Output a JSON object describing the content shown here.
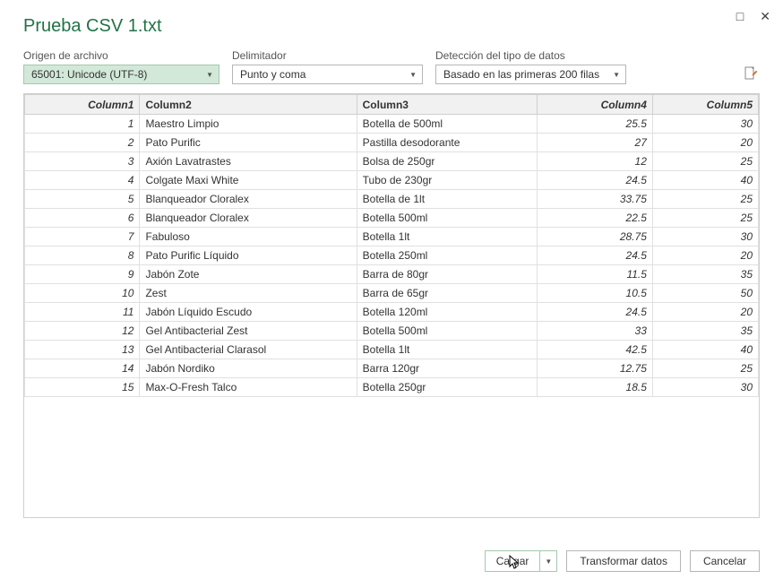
{
  "window": {
    "title": "Prueba CSV 1.txt"
  },
  "controls": {
    "origin_label": "Origen de archivo",
    "origin_value": "65001: Unicode (UTF-8)",
    "delimiter_label": "Delimitador",
    "delimiter_value": "Punto y coma",
    "detect_label": "Detección del tipo de datos",
    "detect_value": "Basado en las primeras 200 filas"
  },
  "table": {
    "headers": [
      "Column1",
      "Column2",
      "Column3",
      "Column4",
      "Column5"
    ],
    "rows": [
      {
        "c1": "1",
        "c2": "Maestro Limpio",
        "c3": "Botella de 500ml",
        "c4": "25.5",
        "c5": "30"
      },
      {
        "c1": "2",
        "c2": "Pato Purific",
        "c3": "Pastilla desodorante",
        "c4": "27",
        "c5": "20"
      },
      {
        "c1": "3",
        "c2": "Axión Lavatrastes",
        "c3": "Bolsa de 250gr",
        "c4": "12",
        "c5": "25"
      },
      {
        "c1": "4",
        "c2": "Colgate Maxi White",
        "c3": "Tubo de 230gr",
        "c4": "24.5",
        "c5": "40"
      },
      {
        "c1": "5",
        "c2": "Blanqueador Cloralex",
        "c3": "Botella de 1lt",
        "c4": "33.75",
        "c5": "25"
      },
      {
        "c1": "6",
        "c2": "Blanqueador Cloralex",
        "c3": "Botella 500ml",
        "c4": "22.5",
        "c5": "25"
      },
      {
        "c1": "7",
        "c2": "Fabuloso",
        "c3": "Botella 1lt",
        "c4": "28.75",
        "c5": "30"
      },
      {
        "c1": "8",
        "c2": "Pato Purific Líquido",
        "c3": "Botella 250ml",
        "c4": "24.5",
        "c5": "20"
      },
      {
        "c1": "9",
        "c2": "Jabón Zote",
        "c3": "Barra de 80gr",
        "c4": "11.5",
        "c5": "35"
      },
      {
        "c1": "10",
        "c2": "Zest",
        "c3": "Barra de 65gr",
        "c4": "10.5",
        "c5": "50"
      },
      {
        "c1": "11",
        "c2": "Jabón Líquido Escudo",
        "c3": "Botella 120ml",
        "c4": "24.5",
        "c5": "20"
      },
      {
        "c1": "12",
        "c2": "Gel Antibacterial Zest",
        "c3": "Botella 500ml",
        "c4": "33",
        "c5": "35"
      },
      {
        "c1": "13",
        "c2": "Gel Antibacterial Clarasol",
        "c3": "Botella 1lt",
        "c4": "42.5",
        "c5": "40"
      },
      {
        "c1": "14",
        "c2": "Jabón Nordiko",
        "c3": "Barra 120gr",
        "c4": "12.75",
        "c5": "25"
      },
      {
        "c1": "15",
        "c2": "Max-O-Fresh Talco",
        "c3": "Botella 250gr",
        "c4": "18.5",
        "c5": "30"
      }
    ]
  },
  "footer": {
    "load": "Cargar",
    "transform": "Transformar datos",
    "cancel": "Cancelar"
  }
}
